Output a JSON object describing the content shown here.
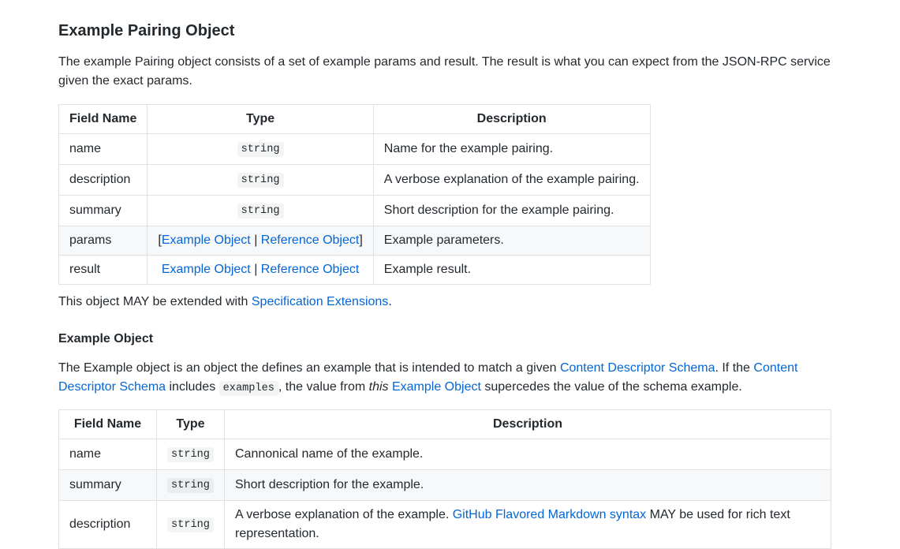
{
  "section": {
    "title": "Example Pairing Object",
    "intro": "The example Pairing object consists of a set of example params and result. The result is what you can expect from the JSON-RPC service given the exact params."
  },
  "pairing_table": {
    "headers": [
      "Field Name",
      "Type",
      "Description"
    ],
    "rows": [
      {
        "field": "name",
        "type": "string",
        "desc": "Name for the example pairing."
      },
      {
        "field": "description",
        "type": "string",
        "desc": "A verbose explanation of the example pairing."
      },
      {
        "field": "summary",
        "type": "string",
        "desc": "Short description for the example pairing."
      },
      {
        "field": "params",
        "type_open": "[",
        "type_link1": "Example Object",
        "type_sep": " | ",
        "type_link2": "Reference Object",
        "type_close": "]",
        "desc": "Example parameters."
      },
      {
        "field": "result",
        "type_link1": "Example Object",
        "type_sep": " | ",
        "type_link2": "Reference Object",
        "desc": "Example result."
      }
    ]
  },
  "extension_note": {
    "prefix": "This object MAY be extended with ",
    "link": "Specification Extensions",
    "suffix": "."
  },
  "example_object": {
    "title": "Example Object",
    "intro_1": "The Example object is an object the defines an example that is intended to match a given ",
    "link_1": "Content Descriptor Schema",
    "intro_2": ". If the ",
    "link_2": "Content Descriptor Schema",
    "intro_3": " includes ",
    "code": "examples",
    "intro_4": ", the value from ",
    "em": "this",
    "intro_5": " ",
    "link_3": "Example Object",
    "intro_6": " supercedes the value of the schema example."
  },
  "example_table": {
    "headers": [
      "Field Name",
      "Type",
      "Description"
    ],
    "rows": [
      {
        "field": "name",
        "type": "string",
        "desc": "Cannonical name of the example."
      },
      {
        "field": "summary",
        "type": "string",
        "desc": "Short description for the example."
      },
      {
        "field": "description",
        "type": "string",
        "desc_1": "A verbose explanation of the example. ",
        "desc_link": "GitHub Flavored Markdown syntax",
        "desc_2": " MAY be used for rich text representation."
      }
    ]
  }
}
